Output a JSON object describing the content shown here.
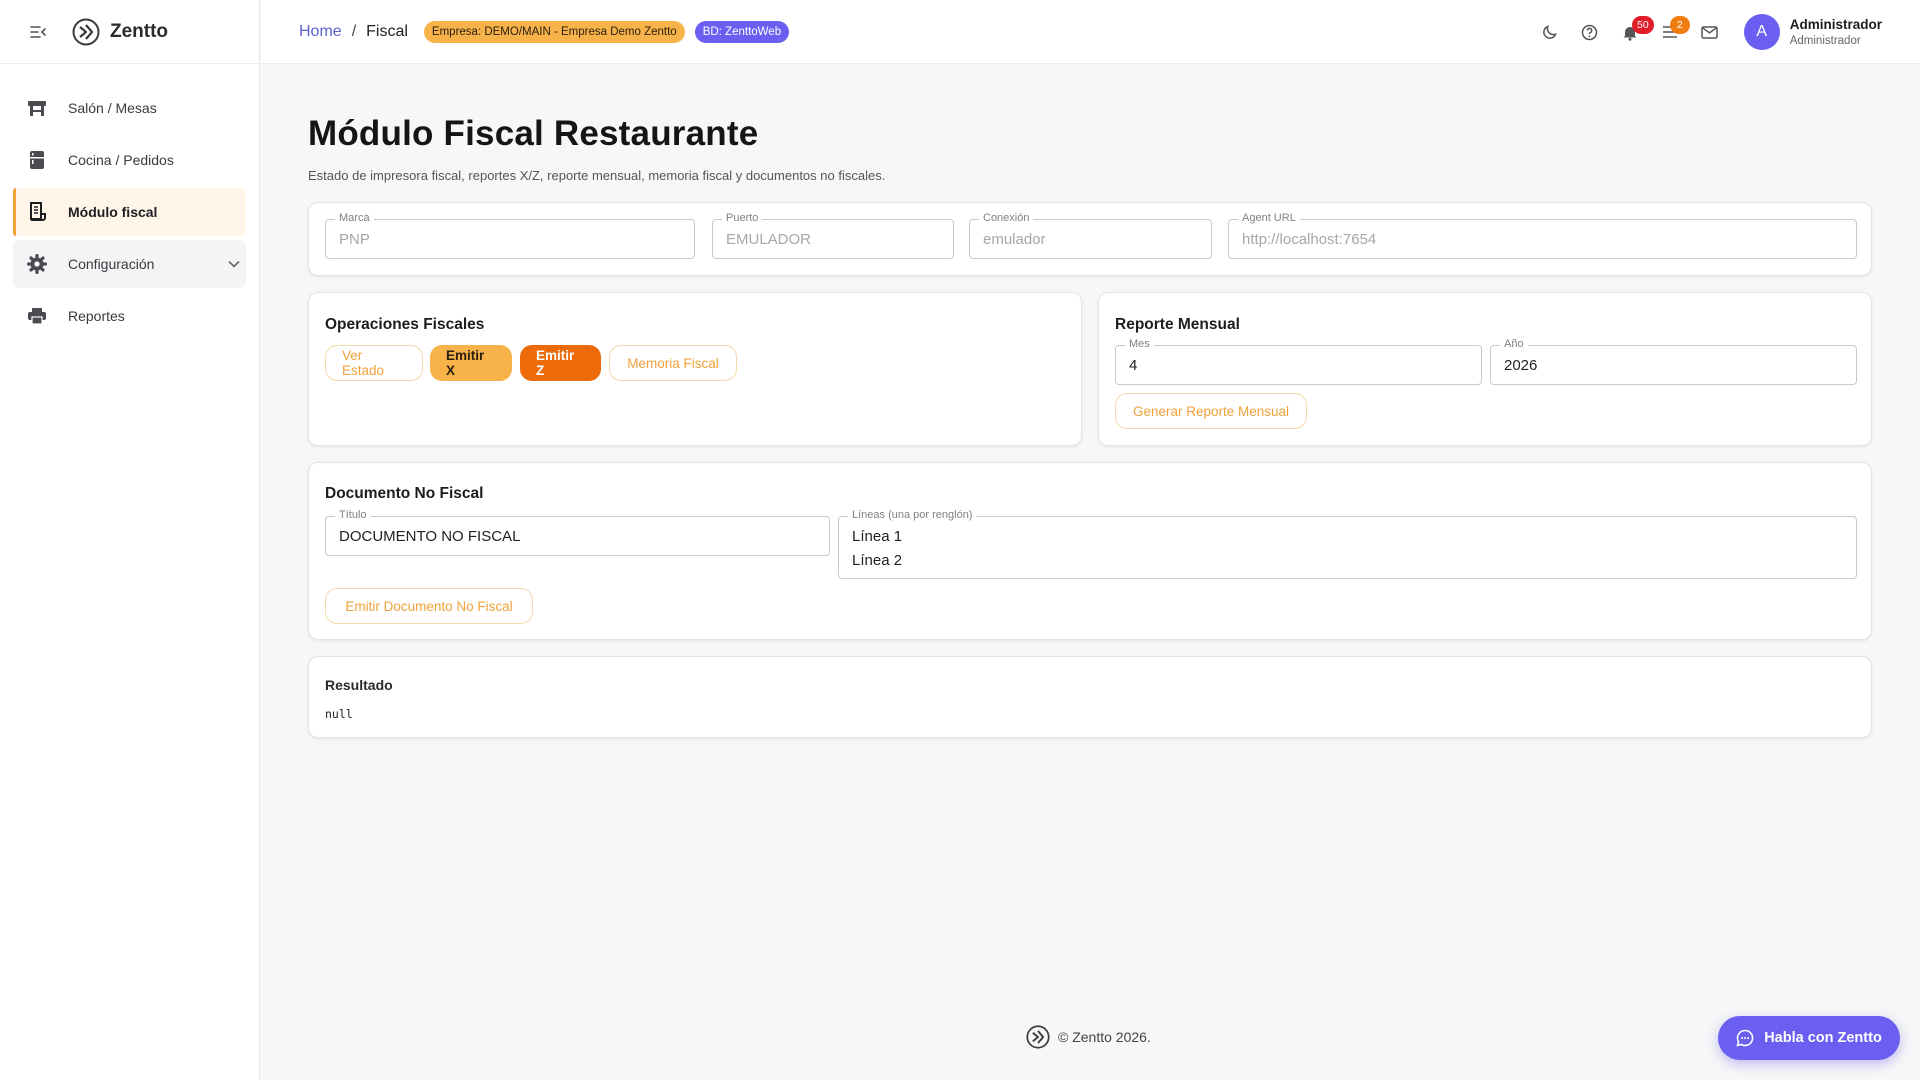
{
  "app": {
    "name": "Zentto"
  },
  "sidebar": {
    "items": [
      {
        "label": "Salón / Mesas"
      },
      {
        "label": "Cocina / Pedidos"
      },
      {
        "label": "Módulo fiscal"
      },
      {
        "label": "Configuración"
      },
      {
        "label": "Reportes"
      }
    ]
  },
  "header": {
    "breadcrumb": {
      "home": "Home",
      "sep": "/",
      "current": "Fiscal"
    },
    "company_chip": "Empresa: DEMO/MAIN - Empresa Demo Zentto",
    "db_chip": "BD: ZenttoWeb",
    "notifications_count": "50",
    "tasks_count": "2",
    "user": {
      "initial": "A",
      "name": "Administrador",
      "role": "Administrador"
    }
  },
  "page": {
    "title": "Módulo Fiscal Restaurante",
    "subtitle": "Estado de impresora fiscal, reportes X/Z, reporte mensual, memoria fiscal y documentos no fiscales."
  },
  "config": {
    "marca": {
      "label": "Marca",
      "value": "PNP"
    },
    "puerto": {
      "label": "Puerto",
      "value": "EMULADOR"
    },
    "conexion": {
      "label": "Conexión",
      "value": "emulador"
    },
    "agent_url": {
      "label": "Agent URL",
      "value": "http://localhost:7654"
    }
  },
  "operations": {
    "title": "Operaciones Fiscales",
    "ver_estado": "Ver Estado",
    "emitir_x": "Emitir X",
    "emitir_z": "Emitir Z",
    "memoria_fiscal": "Memoria Fiscal"
  },
  "monthly": {
    "title": "Reporte Mensual",
    "mes": {
      "label": "Mes",
      "value": "4"
    },
    "anio": {
      "label": "Año",
      "value": "2026"
    },
    "generate": "Generar Reporte Mensual"
  },
  "non_fiscal": {
    "title": "Documento No Fiscal",
    "titulo": {
      "label": "Título",
      "value": "DOCUMENTO NO FISCAL"
    },
    "lineas": {
      "label": "Líneas (una por renglón)",
      "line1": "Línea 1",
      "line2": "Línea 2"
    },
    "emit": "Emitir Documento No Fiscal"
  },
  "result": {
    "title": "Resultado",
    "value": "null"
  },
  "footer": {
    "text": "© Zentto 2026."
  },
  "chat": {
    "label": "Habla con Zentto"
  },
  "colors": {
    "accent": "#f2a33b",
    "primary": "#6a5ff0",
    "danger": "#e11d2a",
    "orange": "#ec6a08"
  }
}
